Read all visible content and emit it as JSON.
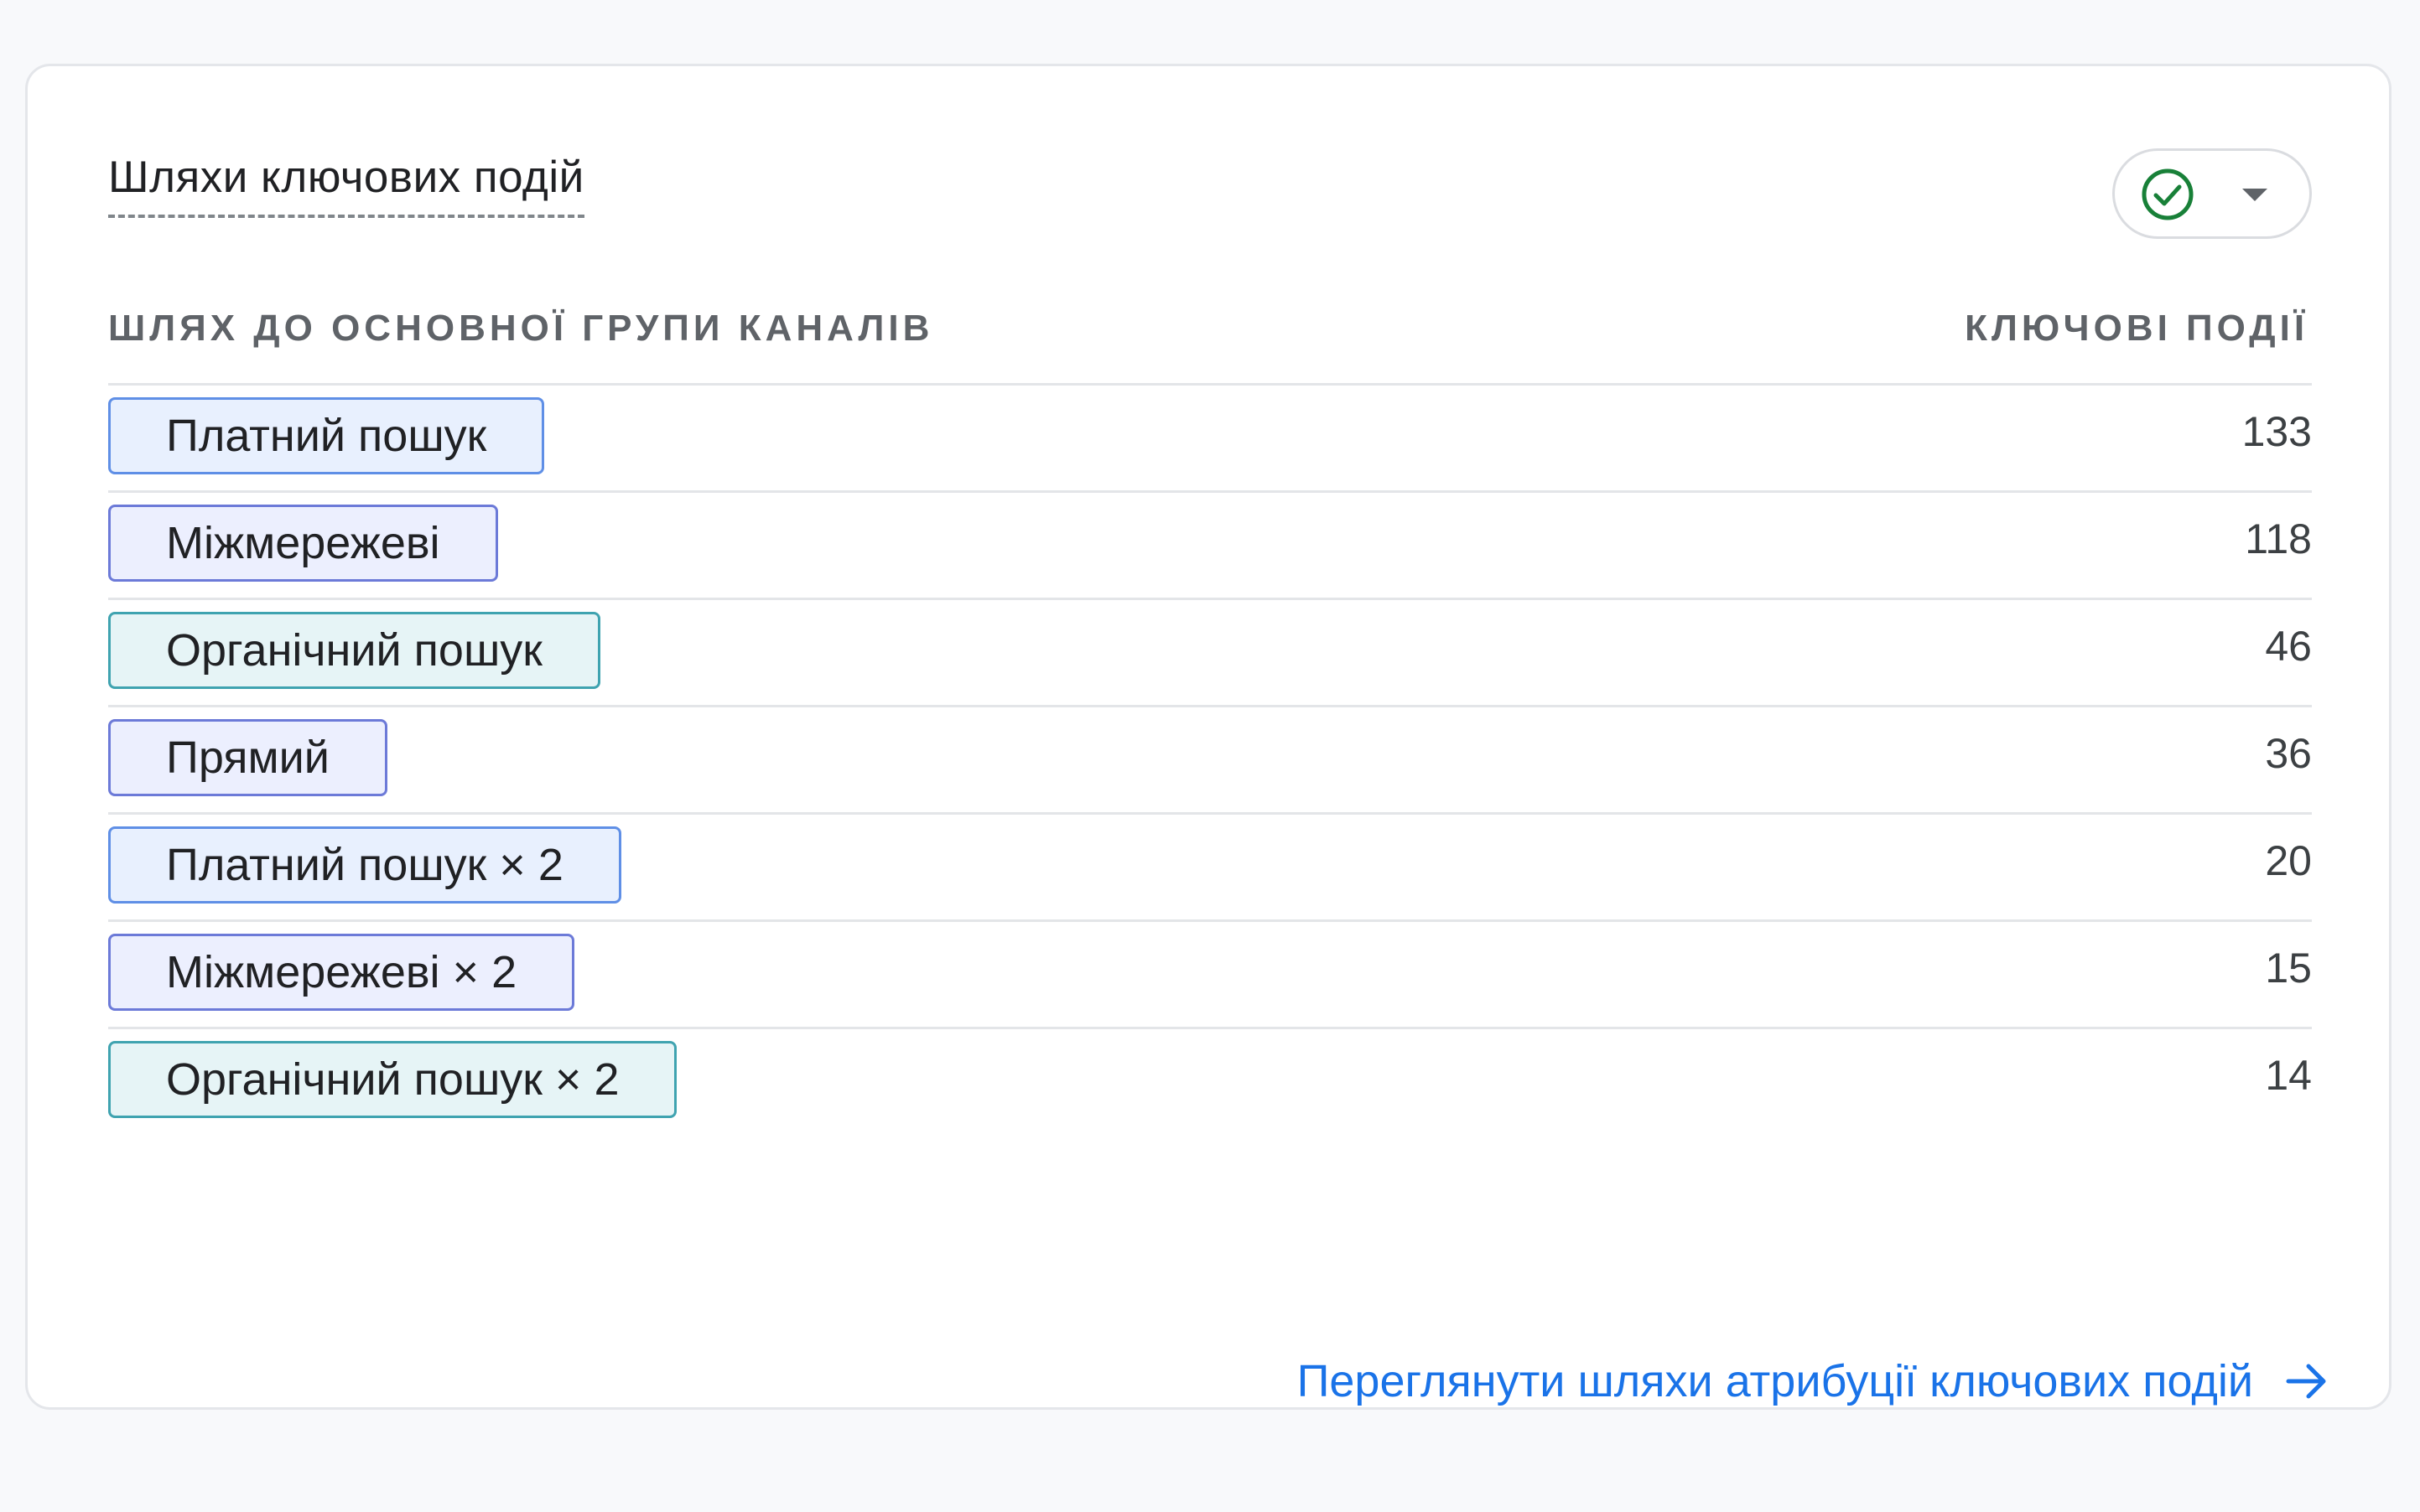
{
  "card": {
    "title": "Шляхи ключових подій",
    "picker": {
      "icon": "check-circle-icon",
      "caret_icon": "chevron-down-icon",
      "accent": "#188038"
    },
    "columns": {
      "left": "ШЛЯХ ДО ОСНОВНОЇ ГРУПИ КАНАЛІВ",
      "right": "КЛЮЧОВІ ПОДІЇ"
    },
    "rows": [
      {
        "label": "Платний пошук",
        "value": "133",
        "color": "blue"
      },
      {
        "label": "Міжмережеві",
        "value": "118",
        "color": "indigo"
      },
      {
        "label": "Органічний пошук",
        "value": "46",
        "color": "teal"
      },
      {
        "label": "Прямий",
        "value": "36",
        "color": "indigo"
      },
      {
        "label": "Платний пошук × 2",
        "value": "20",
        "color": "blue"
      },
      {
        "label": "Міжмережеві × 2",
        "value": "15",
        "color": "indigo"
      },
      {
        "label": "Органічний пошук × 2",
        "value": "14",
        "color": "teal"
      }
    ],
    "footer": {
      "link_label": "Переглянути шляхи атрибуції ключових подій",
      "link_icon": "arrow-right-icon",
      "link_color": "#1a73e8"
    }
  }
}
